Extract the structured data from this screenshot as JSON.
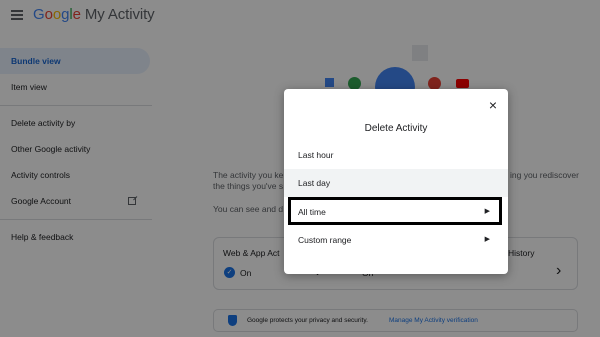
{
  "header": {
    "logo_google": [
      "G",
      "o",
      "o",
      "g",
      "l",
      "e"
    ],
    "logo_rest": "My Activity"
  },
  "sidebar": {
    "items": [
      {
        "label": "Bundle view"
      },
      {
        "label": "Item view"
      },
      {
        "label": "Delete activity by"
      },
      {
        "label": "Other Google activity"
      },
      {
        "label": "Activity controls"
      },
      {
        "label": "Google Account"
      },
      {
        "label": "Help & feedback"
      }
    ]
  },
  "main": {
    "intro_left": "The activity you ke",
    "intro_right": "ing you rediscover",
    "intro_line2": "the things you've s",
    "see_text": "You can see and d",
    "cards": [
      {
        "title": "Web & App Act",
        "status": "On"
      },
      {
        "title": "",
        "status": "On"
      },
      {
        "title": "History",
        "status": ""
      }
    ],
    "privacy_text": "Google protects your privacy and security.",
    "privacy_link": "Manage My Activity verification"
  },
  "dialog": {
    "title": "Delete Activity",
    "close": "×",
    "options": [
      {
        "label": "Last hour"
      },
      {
        "label": "Last day"
      },
      {
        "label": "All time"
      },
      {
        "label": "Custom range"
      }
    ]
  },
  "colors": {
    "accent": "#1a73e8",
    "overlay": "rgba(0,0,0,0.45)"
  }
}
